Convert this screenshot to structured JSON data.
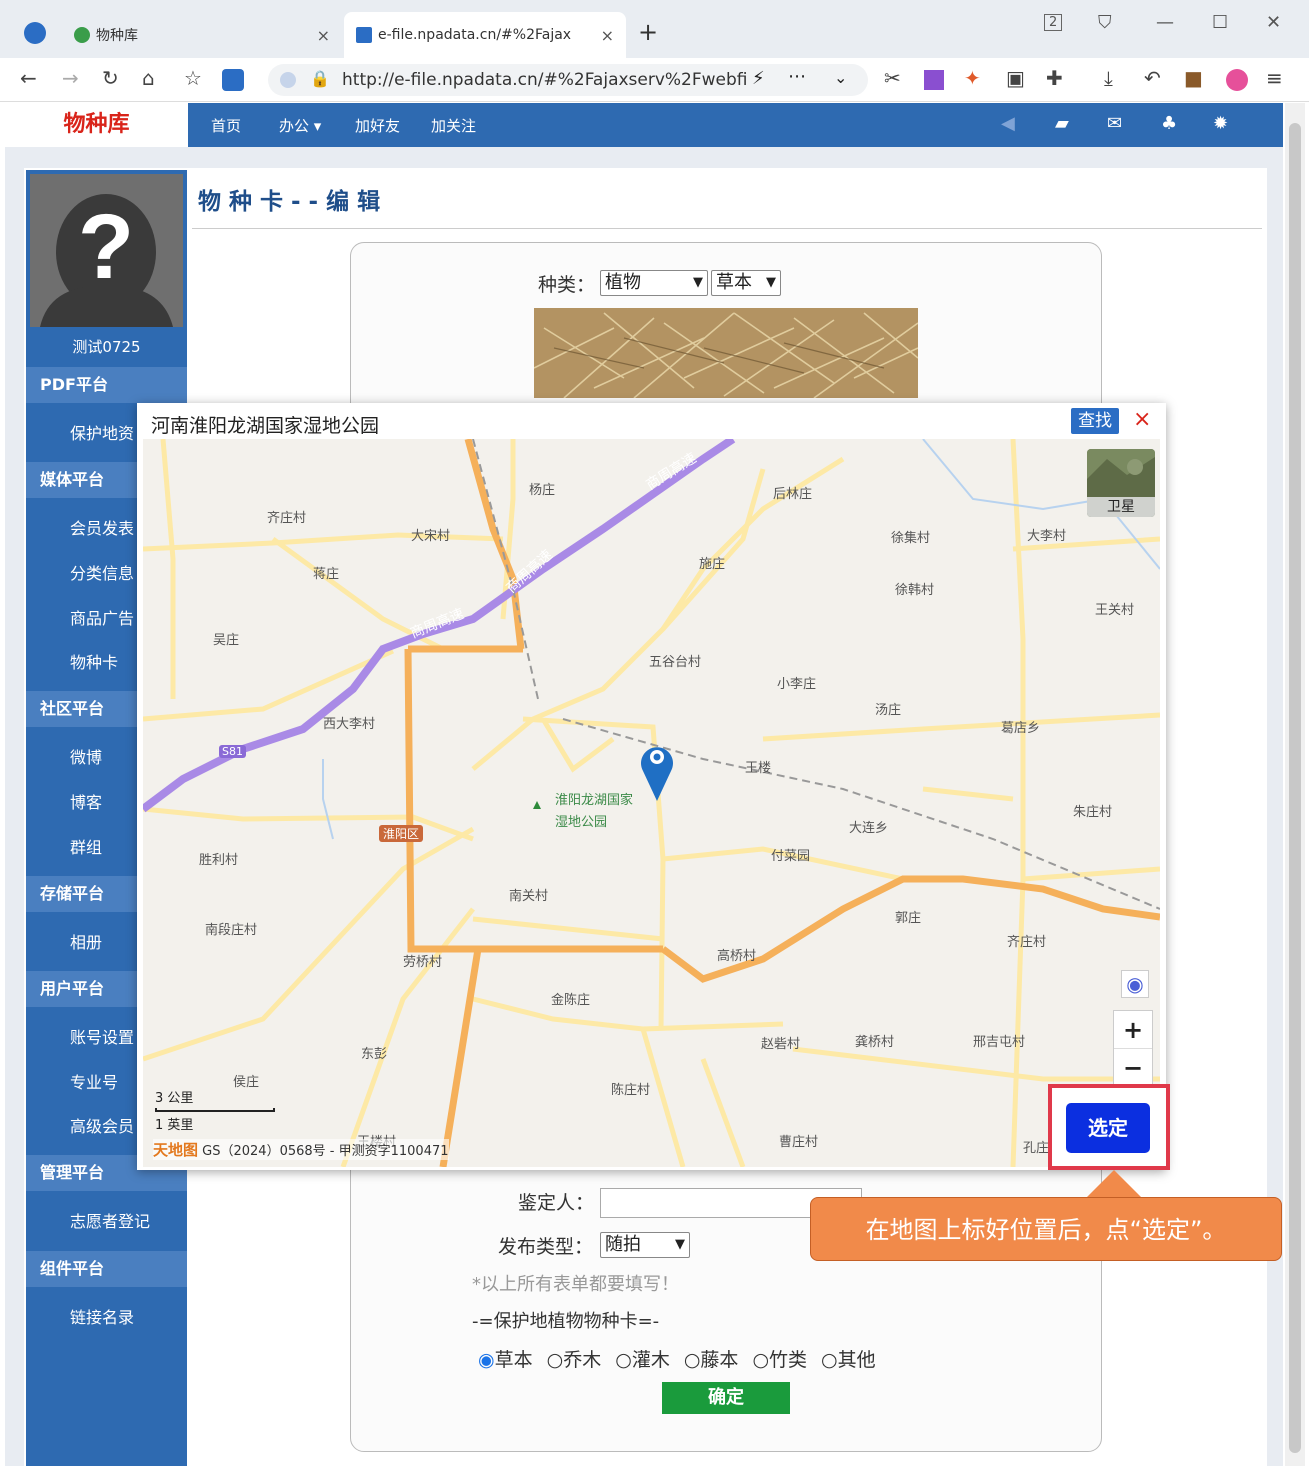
{
  "browser": {
    "tabs": [
      {
        "title": "物种库",
        "close": "×"
      },
      {
        "title": "e-file.npadata.cn/#%2Fajax",
        "close": "×"
      }
    ],
    "new_tab": "+",
    "tab_count": "2",
    "url": "http://e-file.npadata.cn/#%2Fajaxserv%2Fwebfi"
  },
  "nav": {
    "brand": "物种库",
    "links": [
      "首页",
      "办公 ▾",
      "加好友",
      "加关注"
    ]
  },
  "sidebar": {
    "username": "测试0725",
    "sections": [
      {
        "title": "PDF平台",
        "items": [
          "保护地资"
        ]
      },
      {
        "title": "媒体平台",
        "items": [
          "会员发表",
          "分类信息",
          "商品广告",
          "物种卡"
        ]
      },
      {
        "title": "社区平台",
        "items": [
          "微博",
          "博客",
          "群组"
        ]
      },
      {
        "title": "存储平台",
        "items": [
          "相册"
        ]
      },
      {
        "title": "用户平台",
        "items": [
          "账号设置",
          "专业号",
          "高级会员"
        ]
      },
      {
        "title": "管理平台",
        "items": [
          "志愿者登记"
        ]
      },
      {
        "title": "组件平台",
        "items": [
          "链接名录"
        ]
      }
    ]
  },
  "page": {
    "title": "物种卡--编辑",
    "species_label": "种类：",
    "species_value": "植物",
    "species_sub_value": "草本",
    "identifier_label": "鉴定人：",
    "identifier_value": "",
    "publish_label": "发布类型：",
    "publish_value": "随拍",
    "required_hint": "*以上所有表单都要填写！",
    "section_label": "-=保护地植物物种卡=-",
    "radio_options": [
      "草本",
      "乔木",
      "灌木",
      "藤本",
      "竹类",
      "其他"
    ],
    "radio_selected": "草本",
    "confirm_button": "确定"
  },
  "map_dialog": {
    "title": "河南淮阳龙湖国家湿地公园",
    "find_button": "查找",
    "close": "×",
    "satellite_label": "卫星",
    "zoom_in": "+",
    "zoom_out": "−",
    "scale_km": "3 公里",
    "scale_mi": "1 英里",
    "copyright": "GS（2024）0568号 - 甲测资字1100471",
    "select_button": "选定",
    "labels": [
      "杨庄",
      "后林庄",
      "齐庄村",
      "大宋村",
      "施庄",
      "徐集村",
      "大李村",
      "蒋庄",
      "徐韩村",
      "王关村",
      "吴庄",
      "五谷台村",
      "小李庄",
      "汤庄",
      "西大李村",
      "葛店乡",
      "王楼",
      "淮阳龙湖国家",
      "湿地公园",
      "朱庄村",
      "大连乡",
      "淮阳区",
      "付菜园",
      "胜利村",
      "南关村",
      "郭庄",
      "南段庄村",
      "齐庄村",
      "劳桥村",
      "高桥村",
      "金陈庄",
      "东彭",
      "赵砦村",
      "龚桥村",
      "邢吉屯村",
      "侯庄",
      "陈庄村",
      "曹庄村",
      "王楼村",
      "孔庄",
      "商周高速",
      "商周高速",
      "商周高速",
      "S81"
    ]
  },
  "callout": "在地图上标好位置后，点“选定”。"
}
